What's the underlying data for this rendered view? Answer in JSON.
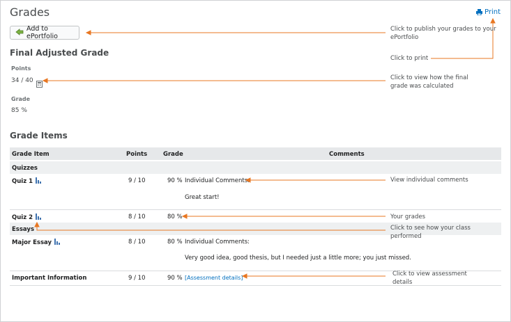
{
  "page": {
    "title": "Grades",
    "print_label": "Print",
    "add_button_label": "Add to ePortfolio"
  },
  "final": {
    "heading": "Final Adjusted Grade",
    "points_label": "Points",
    "points_value": "34 / 40",
    "grade_label": "Grade",
    "grade_value": "85 %"
  },
  "grade_items": {
    "heading": "Grade Items",
    "columns": {
      "item": "Grade Item",
      "points": "Points",
      "grade": "Grade",
      "comments": "Comments"
    },
    "categories": {
      "quizzes": "Quizzes",
      "essays": "Essays"
    },
    "rows": [
      {
        "name": "Quiz 1",
        "points": "9 / 10",
        "grade": "90 %",
        "comment_label": "Individual Comments:",
        "comment": "Great start!"
      },
      {
        "name": "Quiz 2",
        "points": "8 / 10",
        "grade": "80 %"
      },
      {
        "name": "Major Essay",
        "points": "8 / 10",
        "grade": "80 %",
        "comment_label": "Individual Comments:",
        "comment": "Very good idea, good thesis, but I needed just a little more; you just missed."
      },
      {
        "name": "Important Information",
        "points": "9 / 10",
        "grade": "90 %",
        "link": "[Assessment details]"
      }
    ]
  },
  "annotations": {
    "publish": "Click to publish your grades to your ePortfolio",
    "print": "Click to print",
    "final_calc": "Click to view how the final grade was calculated",
    "comments": "View individual comments",
    "grades": "Your grades",
    "class_perf": "Click to see how your class performed",
    "assessment": "Click to view assessment details"
  },
  "colors": {
    "accent": "#006fbf",
    "annotation_line": "#e87722",
    "header_bg": "#e6e8ea"
  },
  "icons": {
    "print": "printer-icon",
    "add": "portfolio-add-icon",
    "calculator": "calculator-icon",
    "stats": "bar-chart-icon"
  }
}
